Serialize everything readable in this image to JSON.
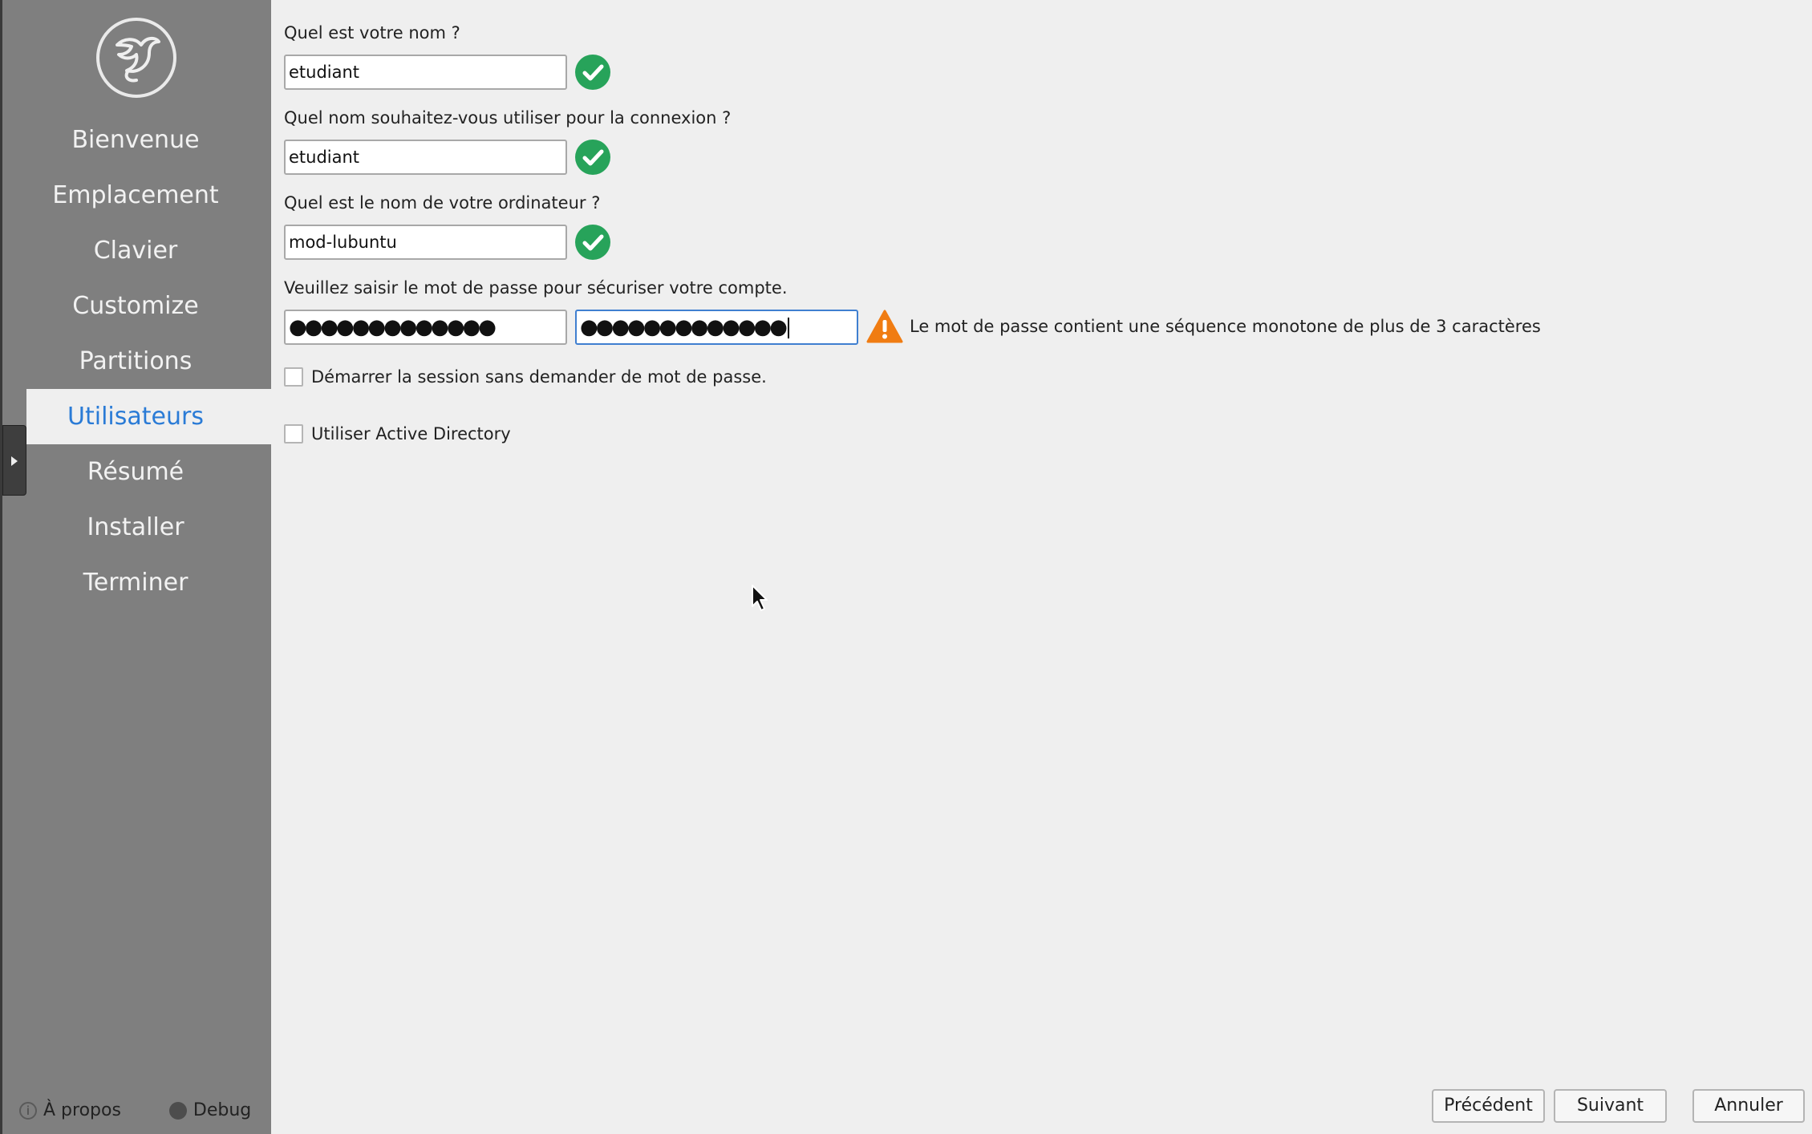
{
  "sidebar": {
    "logo_icon": "lubuntu-bird-logo-icon",
    "items": [
      {
        "label": "Bienvenue",
        "active": false
      },
      {
        "label": "Emplacement",
        "active": false
      },
      {
        "label": "Clavier",
        "active": false
      },
      {
        "label": "Customize",
        "active": false
      },
      {
        "label": "Partitions",
        "active": false
      },
      {
        "label": "Utilisateurs",
        "active": true
      },
      {
        "label": "Résumé",
        "active": false
      },
      {
        "label": "Installer",
        "active": false
      },
      {
        "label": "Terminer",
        "active": false
      }
    ],
    "about_label": "À propos",
    "debug_label": "Debug"
  },
  "form": {
    "name_question": "Quel est votre nom ?",
    "name_value": "etudiant",
    "login_question": "Quel nom souhaitez-vous utiliser pour la connexion ?",
    "login_value": "etudiant",
    "computer_question": "Quel est le nom de votre ordinateur ?",
    "computer_value": "mod-lubuntu",
    "password_question": "Veuillez saisir le mot de passe pour sécuriser votre compte.",
    "password_mask": "●●●●●●●●●●●●●",
    "password_confirm_mask": "●●●●●●●●●●●●●",
    "password_warning": "Le mot de passe contient une séquence monotone de plus de 3 caractères",
    "autologin_label": "Démarrer la session sans demander de mot de passe.",
    "autologin_checked": false,
    "active_directory_label": "Utiliser Active Directory",
    "active_directory_checked": false
  },
  "buttons": {
    "back": "Précédent",
    "next": "Suivant",
    "cancel": "Annuler"
  },
  "colors": {
    "accent": "#2a7bd6",
    "valid": "#27a35a",
    "warning": "#f07c12",
    "sidebar_bg": "#7f7f7f"
  }
}
